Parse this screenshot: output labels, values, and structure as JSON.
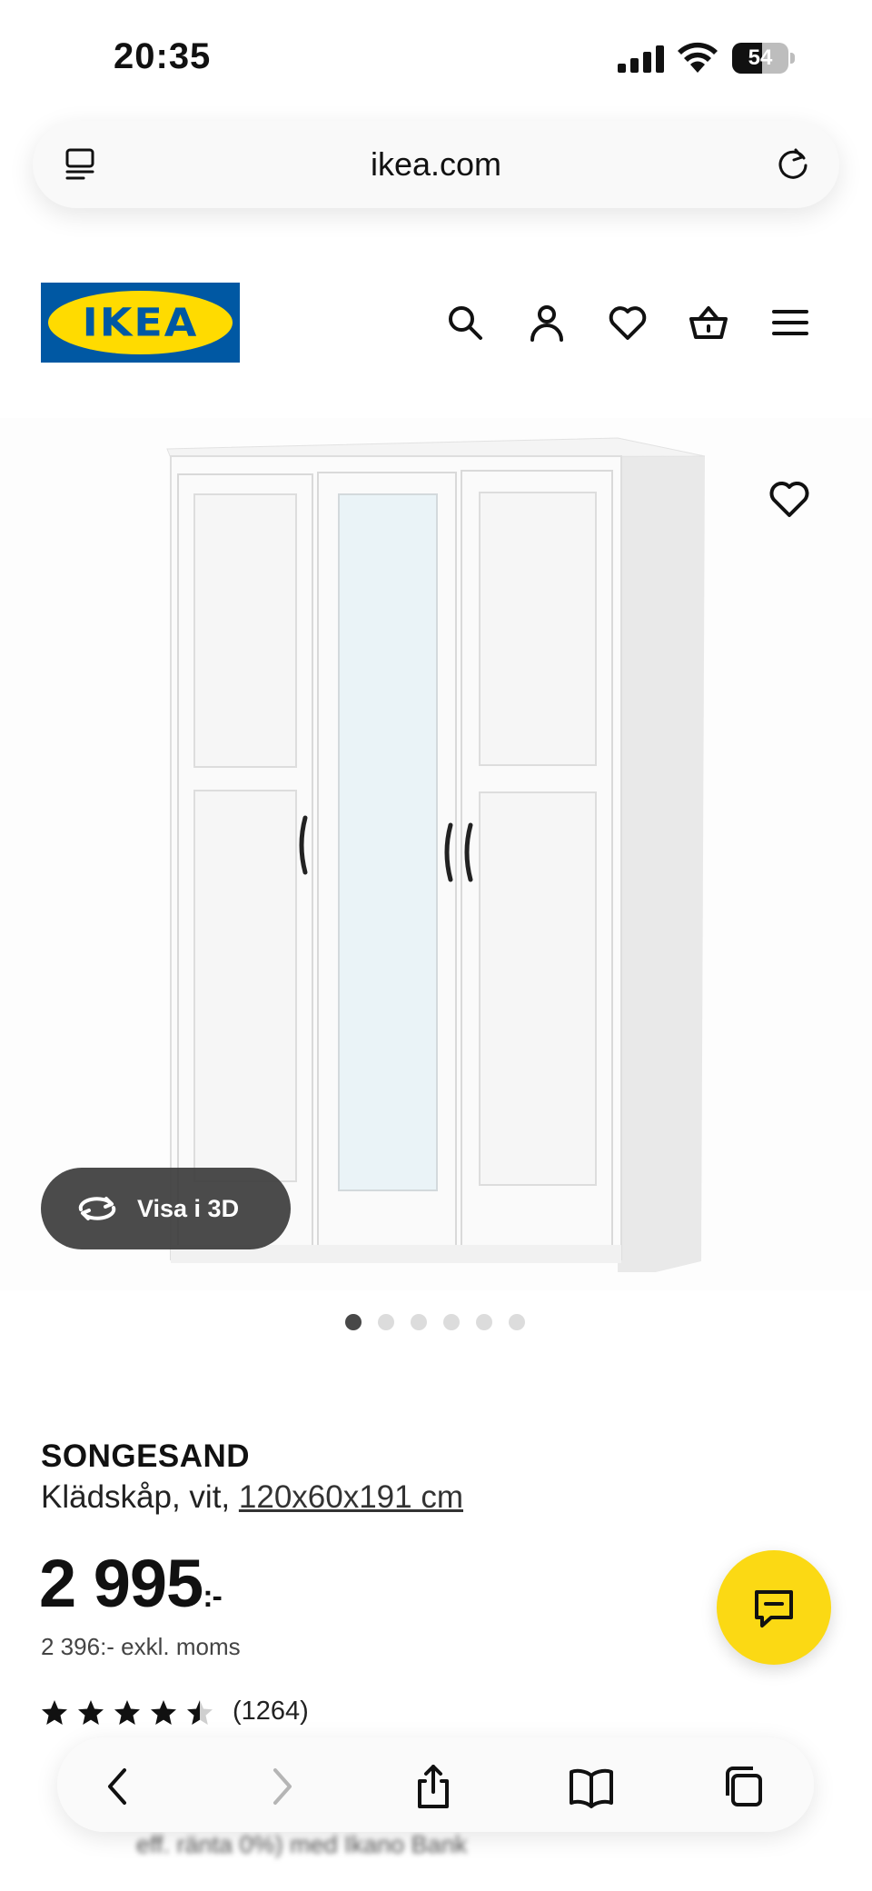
{
  "status_bar": {
    "time": "20:35",
    "battery": "54",
    "battery_level": 0.54
  },
  "browser": {
    "url": "ikea.com"
  },
  "header": {
    "logo_text": "IKEA"
  },
  "gallery": {
    "view_3d_label": "Visa i 3D",
    "dot_count": 6,
    "active_dot": 0
  },
  "product": {
    "name": "SONGESAND",
    "description": "Klädskåp, vit, ",
    "size_link": "120x60x191 cm",
    "price_main": "2 995",
    "price_suffix": ":-",
    "price_ex_vat": "2 396:- exkl. moms",
    "rating": 4.5,
    "review_count": "(1264)"
  },
  "finance": {
    "text": "eff. ränta 0%) med Ikano Bank"
  },
  "colors": {
    "brand_blue": "#0058a3",
    "brand_yellow": "#ffdb00",
    "chat_yellow": "#fbd914"
  },
  "icons": [
    "tabs-icon",
    "reload-icon",
    "search-icon",
    "account-icon",
    "heart-icon",
    "basket-icon",
    "menu-icon",
    "rotate-3d-icon",
    "chat-icon",
    "back-icon",
    "forward-icon",
    "share-icon",
    "bookmarks-icon",
    "tabs-overview-icon"
  ]
}
